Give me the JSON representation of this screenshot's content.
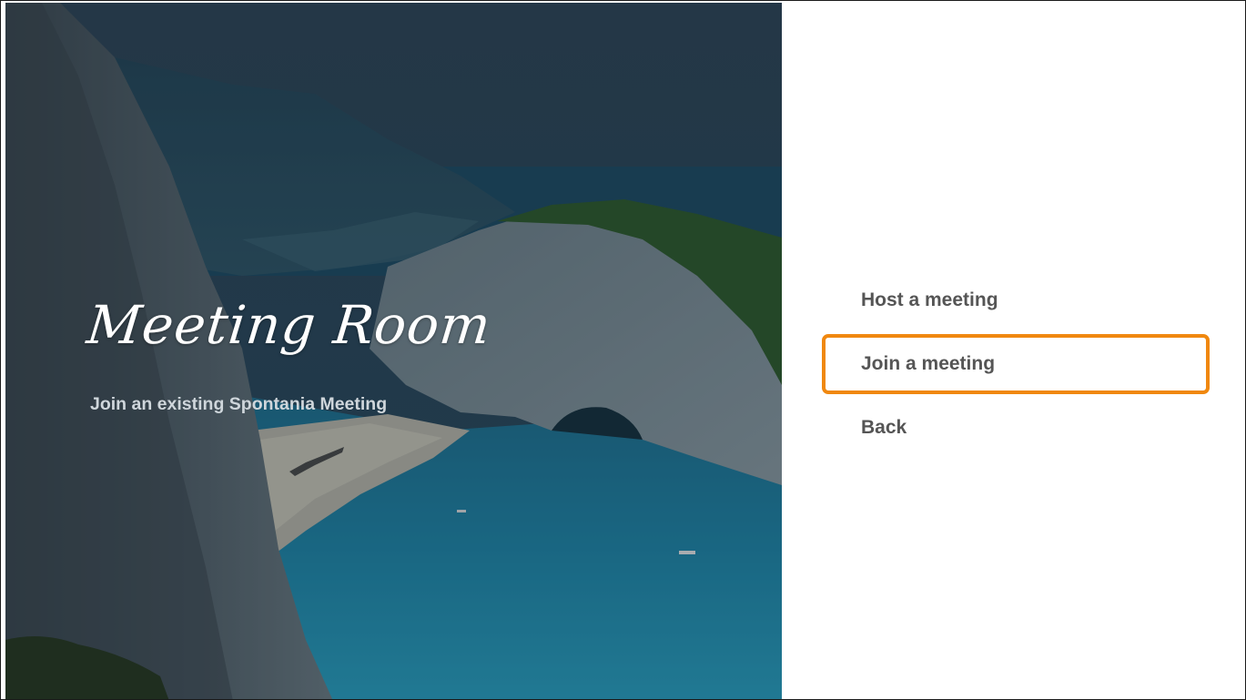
{
  "hero": {
    "title": "Meeting Room",
    "subtitle": "Join an existing Spontania Meeting"
  },
  "menu": {
    "items": [
      {
        "label": "Host a meeting",
        "selected": false
      },
      {
        "label": "Join a meeting",
        "selected": true
      },
      {
        "label": "Back",
        "selected": false
      }
    ]
  },
  "colors": {
    "accent": "#f0880f",
    "menu_text": "#555555",
    "subtitle_text": "#cfd6db"
  }
}
